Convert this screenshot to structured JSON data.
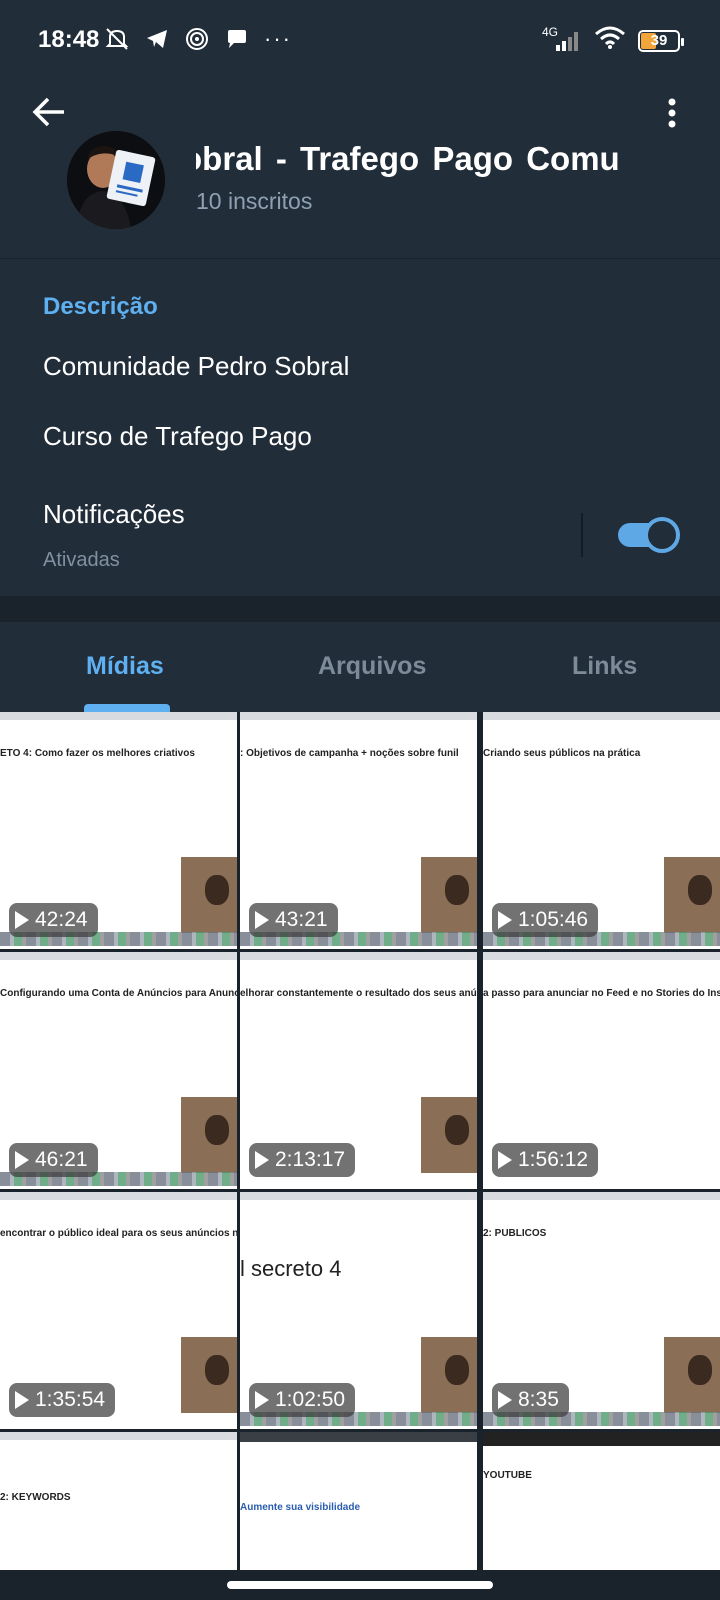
{
  "status_bar": {
    "time": "18:48",
    "icons_left": [
      "mute-bell-icon",
      "telegram-icon",
      "nfc-icon",
      "chat-bubble-icon"
    ],
    "more": "···",
    "network": "4G",
    "battery": "39"
  },
  "header": {
    "title": "obral - Trafego Pago   Comu",
    "subscribers": "10 inscritos"
  },
  "info": {
    "description_label": "Descrição",
    "description_line1": "Comunidade Pedro Sobral",
    "description_line2": "Curso de Trafego Pago",
    "notifications_label": "Notificações",
    "notifications_status": "Ativadas",
    "notifications_on": true
  },
  "tabs": [
    {
      "label": "Mídias",
      "active": true
    },
    {
      "label": "Arquivos",
      "active": false
    },
    {
      "label": "Links",
      "active": false
    }
  ],
  "media": [
    {
      "caption": "ETO 4: Como fazer os melhores criativos",
      "duration": "42:24"
    },
    {
      "caption": ": Objetivos de campanha + noções sobre funil",
      "duration": "43:21"
    },
    {
      "caption": "Criando seus públicos na prática",
      "duration": "1:05:46"
    },
    {
      "caption": "Configurando uma Conta de Anúncios para Anunciar + Noções Sobre Pixel",
      "duration": "46:21"
    },
    {
      "caption": "elhorar constantemente o resultado dos seus anúncios no Ins",
      "duration": "2:13:17"
    },
    {
      "caption": "a passo para anunciar no Feed e no Stories do Instag",
      "duration": "1:56:12"
    },
    {
      "caption": "encontrar o público ideal para os seus anúncios no Insta",
      "duration": "1:35:54"
    },
    {
      "caption": "l secreto 4",
      "duration": "1:02:50"
    },
    {
      "caption": "2: PUBLICOS",
      "duration": "8:35"
    },
    {
      "caption": "2: KEYWORDS",
      "duration": ""
    },
    {
      "caption": "Aumente sua visibilidade",
      "duration": ""
    },
    {
      "caption": "YOUTUBE",
      "duration": ""
    }
  ]
}
